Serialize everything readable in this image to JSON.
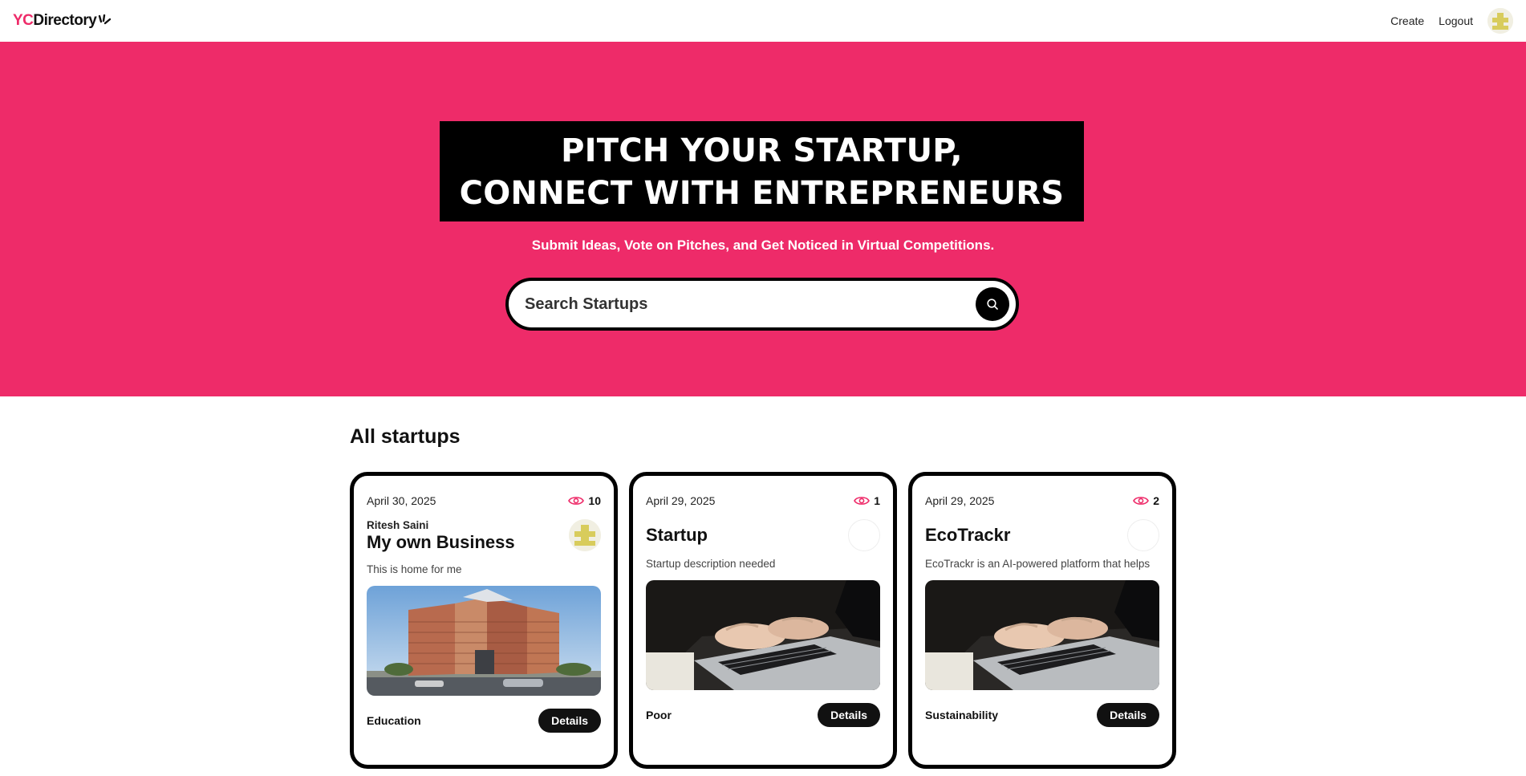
{
  "nav": {
    "logo_yc": "YC",
    "logo_directory": "Directory",
    "links": {
      "create": "Create",
      "logout": "Logout"
    }
  },
  "hero": {
    "title_line1": "PITCH YOUR STARTUP,",
    "title_line2": "CONNECT WITH ENTREPRENEURS",
    "subtitle": "Submit Ideas, Vote on Pitches, and Get Noticed in Virtual Competitions.",
    "search_placeholder": "Search Startups"
  },
  "section": {
    "title": "All startups"
  },
  "startups": [
    {
      "date": "April 30, 2025",
      "views": "10",
      "author": "Ritesh Saini",
      "title": "My own Business",
      "description": "This is home for me",
      "category": "Education",
      "details_label": "Details"
    },
    {
      "date": "April 29, 2025",
      "views": "1",
      "title": "Startup",
      "description": "Startup description needed",
      "category": "Poor",
      "details_label": "Details"
    },
    {
      "date": "April 29, 2025",
      "views": "2",
      "title": "EcoTrackr",
      "description": "EcoTrackr is an AI-powered platform that helps",
      "category": "Sustainability",
      "details_label": "Details"
    }
  ],
  "colors": {
    "brand": "#EE2B69",
    "dark": "#000000",
    "white": "#ffffff"
  }
}
